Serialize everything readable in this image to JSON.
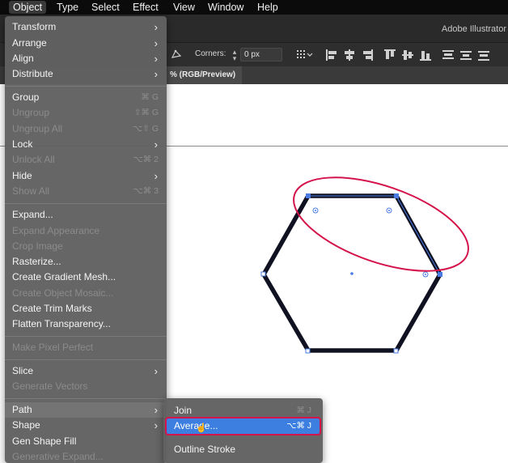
{
  "menubar": {
    "items": [
      "Object",
      "Type",
      "Select",
      "Effect",
      "View",
      "Window",
      "Help"
    ],
    "active": "Object"
  },
  "app": {
    "title": "Adobe Illustrator"
  },
  "controlbar": {
    "corners_label": "Corners:",
    "corners_value": "0 px"
  },
  "document_tab": {
    "label": "% (RGB/Preview)"
  },
  "object_menu": {
    "items": [
      {
        "label": "Transform",
        "submenu": true,
        "enabled": true
      },
      {
        "label": "Arrange",
        "submenu": true,
        "enabled": true
      },
      {
        "label": "Align",
        "submenu": true,
        "enabled": true
      },
      {
        "label": "Distribute",
        "submenu": true,
        "enabled": true
      },
      {
        "label": "Group",
        "shortcut": "⌘ G",
        "enabled": true
      },
      {
        "label": "Ungroup",
        "shortcut": "⇧⌘ G",
        "enabled": false
      },
      {
        "label": "Ungroup All",
        "shortcut": "⌥⇧ G",
        "enabled": false
      },
      {
        "label": "Lock",
        "submenu": true,
        "enabled": true
      },
      {
        "label": "Unlock All",
        "shortcut": "⌥⌘ 2",
        "enabled": false
      },
      {
        "label": "Hide",
        "submenu": true,
        "enabled": true
      },
      {
        "label": "Show All",
        "shortcut": "⌥⌘ 3",
        "enabled": false
      },
      {
        "label": "Expand...",
        "enabled": true
      },
      {
        "label": "Expand Appearance",
        "enabled": false
      },
      {
        "label": "Crop Image",
        "enabled": false
      },
      {
        "label": "Rasterize...",
        "enabled": true
      },
      {
        "label": "Create Gradient Mesh...",
        "enabled": true
      },
      {
        "label": "Create Object Mosaic...",
        "enabled": false
      },
      {
        "label": "Create Trim Marks",
        "enabled": true
      },
      {
        "label": "Flatten Transparency...",
        "enabled": true
      },
      {
        "label": "Make Pixel Perfect",
        "enabled": false
      },
      {
        "label": "Slice",
        "submenu": true,
        "enabled": true
      },
      {
        "label": "Generate Vectors",
        "enabled": false
      },
      {
        "label": "Path",
        "submenu": true,
        "enabled": true,
        "highlighted": true
      },
      {
        "label": "Shape",
        "submenu": true,
        "enabled": true
      },
      {
        "label": "Gen Shape Fill",
        "enabled": true
      },
      {
        "label": "Generative Expand...",
        "enabled": false
      }
    ]
  },
  "path_submenu": {
    "items": [
      {
        "label": "Join",
        "shortcut": "⌘ J",
        "enabled": true
      },
      {
        "label": "Average...",
        "shortcut": "⌥⌘ J",
        "enabled": true,
        "selected": true
      },
      {
        "label": "Outline Stroke",
        "enabled": true
      }
    ]
  },
  "colors": {
    "accent_selection": "#3d7fe0",
    "annotation_red": "#d4144b",
    "shape_stroke": "#101222",
    "anchor_blue": "#4a7be3"
  }
}
